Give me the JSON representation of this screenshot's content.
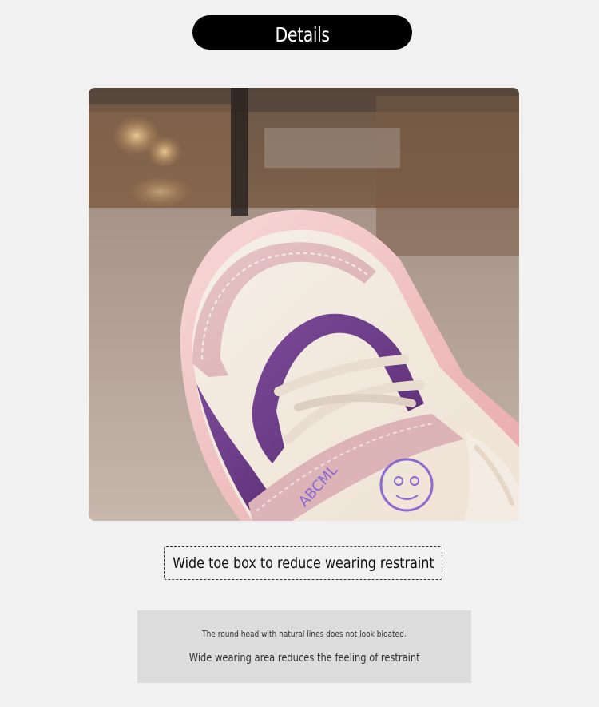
{
  "header": {
    "title": "Details"
  },
  "product_image": {
    "subject": "child sneaker toe close-up",
    "shoe_brand_text": "ABCML"
  },
  "caption": {
    "text": "Wide toe box to reduce wearing restraint"
  },
  "description": {
    "line1": "The round head with natural lines does not look bloated.",
    "line2": "Wide wearing area reduces the feeling of restraint"
  },
  "colors": {
    "background": "#f2f1f1",
    "pill": "#000000",
    "desc_box": "#dcdcdc",
    "shoe_pink": "#e3b8bc",
    "shoe_purple": "#6e3f8a"
  }
}
